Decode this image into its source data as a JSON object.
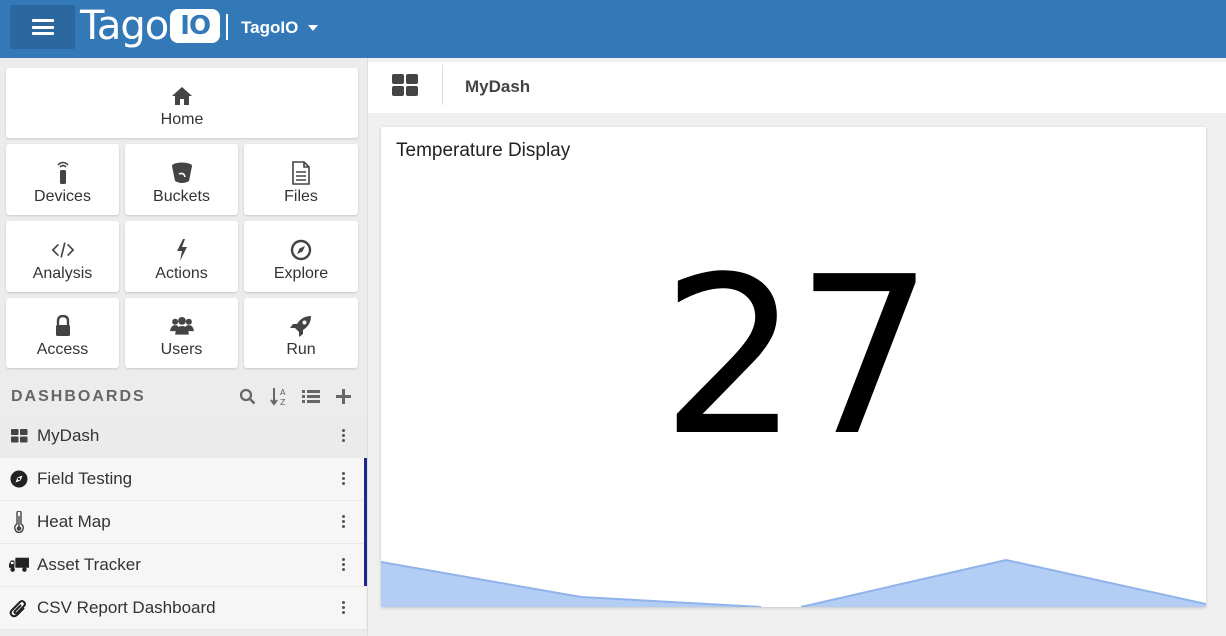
{
  "app": {
    "logo_text": "Tago",
    "logo_badge": "IO",
    "account_name": "TagoIO"
  },
  "sidebar": {
    "tiles": [
      {
        "label": "Home",
        "icon": "home-icon"
      },
      {
        "label": "Devices",
        "icon": "device-icon"
      },
      {
        "label": "Buckets",
        "icon": "bucket-icon"
      },
      {
        "label": "Files",
        "icon": "file-icon"
      },
      {
        "label": "Analysis",
        "icon": "code-icon"
      },
      {
        "label": "Actions",
        "icon": "bolt-icon"
      },
      {
        "label": "Explore",
        "icon": "compass-icon"
      },
      {
        "label": "Access",
        "icon": "lock-icon"
      },
      {
        "label": "Users",
        "icon": "users-icon"
      },
      {
        "label": "Run",
        "icon": "rocket-icon"
      }
    ],
    "dashboards_title": "DASHBOARDS",
    "dashboards": [
      {
        "label": "MyDash",
        "icon": "grid-icon"
      },
      {
        "label": "Field Testing",
        "icon": "compass-icon"
      },
      {
        "label": "Heat Map",
        "icon": "thermometer-icon"
      },
      {
        "label": "Asset Tracker",
        "icon": "truck-icon"
      },
      {
        "label": "CSV Report Dashboard",
        "icon": "paperclip-icon"
      }
    ]
  },
  "main": {
    "breadcrumb_title": "MyDash",
    "widget": {
      "title": "Temperature Display",
      "value": "27"
    }
  },
  "colors": {
    "topbar": "#3479b7",
    "sparkline_fill": "#b3cdf5",
    "sparkline_line": "#8fb3ea"
  }
}
